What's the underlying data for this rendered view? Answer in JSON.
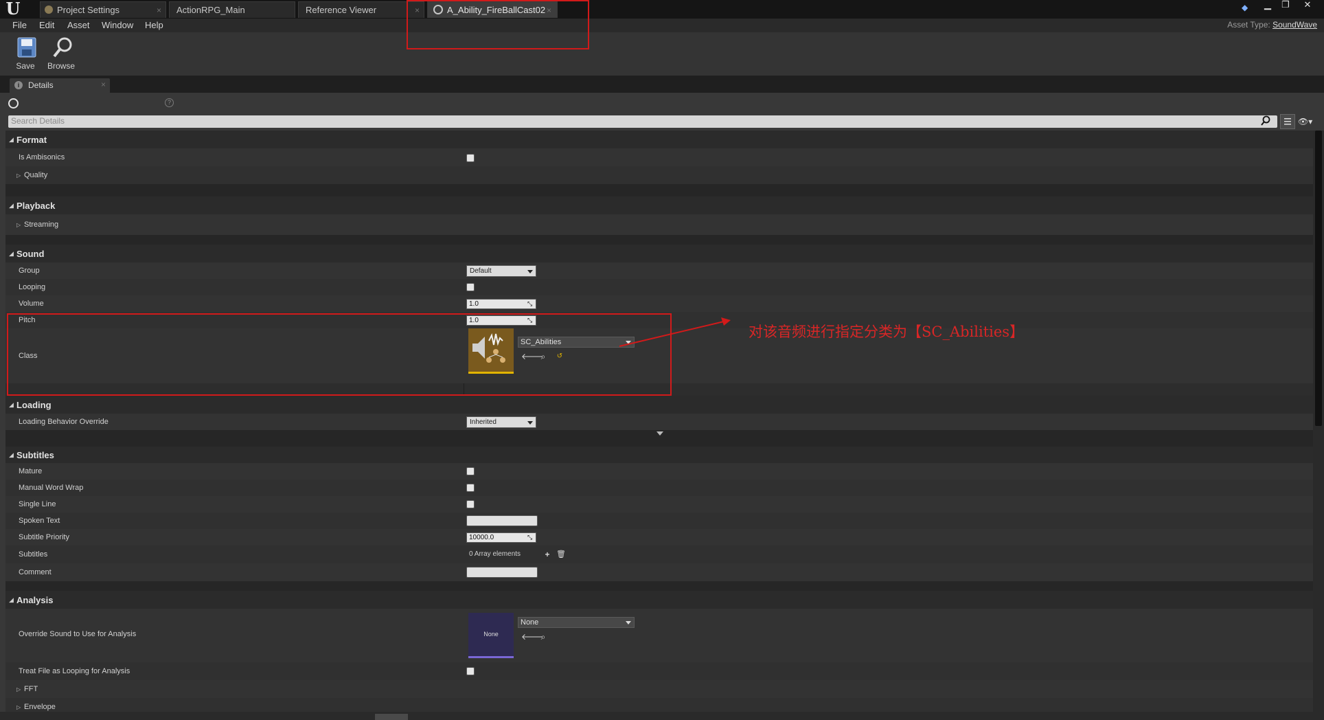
{
  "tabs": [
    {
      "label": "Project Settings",
      "icon": "gear-icon"
    },
    {
      "label": "ActionRPG_Main"
    },
    {
      "label": "Reference Viewer"
    },
    {
      "label": "A_Ability_FireBallCast02",
      "icon": "sound-wave-icon",
      "active": true
    }
  ],
  "menu": [
    "File",
    "Edit",
    "Asset",
    "Window",
    "Help"
  ],
  "asset_type": {
    "label": "Asset Type:",
    "value": "SoundWave"
  },
  "toolbar": {
    "save": "Save",
    "browse": "Browse"
  },
  "details": {
    "tab_label": "Details",
    "search_placeholder": "Search Details"
  },
  "categories": {
    "format": {
      "label": "Format",
      "is_ambisonics": "Is Ambisonics",
      "quality": "Quality"
    },
    "playback": {
      "label": "Playback",
      "streaming": "Streaming"
    },
    "sound": {
      "label": "Sound",
      "group": {
        "label": "Group",
        "value": "Default"
      },
      "looping": {
        "label": "Looping"
      },
      "volume": {
        "label": "Volume",
        "value": "1.0"
      },
      "pitch": {
        "label": "Pitch",
        "value": "1.0"
      },
      "class": {
        "label": "Class",
        "value": "SC_Abilities"
      }
    },
    "loading": {
      "label": "Loading",
      "behavior": {
        "label": "Loading Behavior Override",
        "value": "Inherited"
      }
    },
    "subtitles": {
      "label": "Subtitles",
      "mature": "Mature",
      "manual_word_wrap": "Manual Word Wrap",
      "single_line": "Single Line",
      "spoken_text": "Spoken Text",
      "subtitle_priority": {
        "label": "Subtitle Priority",
        "value": "10000.0"
      },
      "subtitles": {
        "label": "Subtitles",
        "value": "0 Array elements"
      },
      "comment": "Comment"
    },
    "analysis": {
      "label": "Analysis",
      "override_sound": {
        "label": "Override Sound to Use for Analysis",
        "value": "None",
        "thumb_text": "None"
      },
      "treat_looping": "Treat File as Looping for Analysis",
      "fft": "FFT",
      "envelope": "Envelope"
    }
  },
  "annotation": {
    "text": "对该音频进行指定分类为【SC_Abilities】",
    "color": "#d21a1a"
  },
  "colors": {
    "panel_bg": "#2d2d2d",
    "accent_yellow": "#e2b400"
  }
}
